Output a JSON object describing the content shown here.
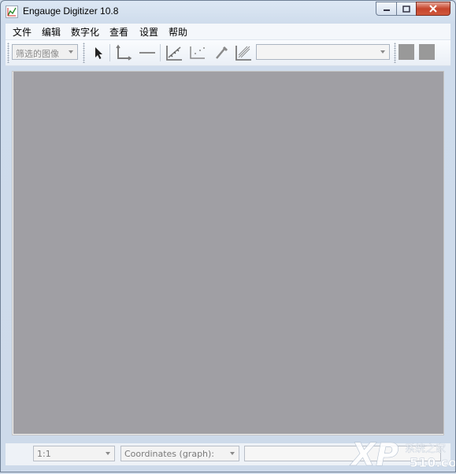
{
  "window": {
    "title": "Engauge Digitizer 10.8",
    "controls": {
      "minimize": "minimize-icon",
      "maximize": "maximize-icon",
      "close": "close-icon"
    }
  },
  "menubar": {
    "items": [
      {
        "label": "文件"
      },
      {
        "label": "编辑"
      },
      {
        "label": "数字化"
      },
      {
        "label": "查看"
      },
      {
        "label": "设置"
      },
      {
        "label": "帮助"
      }
    ]
  },
  "toolbar": {
    "image_filter": {
      "selected": "筛选的图像"
    },
    "tools": [
      {
        "icon": "select-arrow-icon"
      },
      {
        "icon": "axis-point-icon"
      },
      {
        "icon": "scale-bar-icon"
      },
      {
        "icon": "curve-point-icon"
      },
      {
        "icon": "point-match-icon"
      },
      {
        "icon": "color-picker-icon"
      },
      {
        "icon": "segment-fill-icon"
      }
    ],
    "curve_select": {
      "selected": ""
    },
    "square_buttons": [
      "gray-square-1",
      "gray-square-2"
    ]
  },
  "colors": {
    "canvas": "#a09fa4",
    "window_frame": "#cfdbe9",
    "close_button": "#c6452c"
  },
  "statusbar": {
    "zoom": {
      "selected": "1:1"
    },
    "coordinates_mode": {
      "selected": "Coordinates (graph):"
    },
    "coordinates_value": ""
  },
  "watermark": {
    "text": "XP系统之家",
    "sub": "510.com"
  }
}
